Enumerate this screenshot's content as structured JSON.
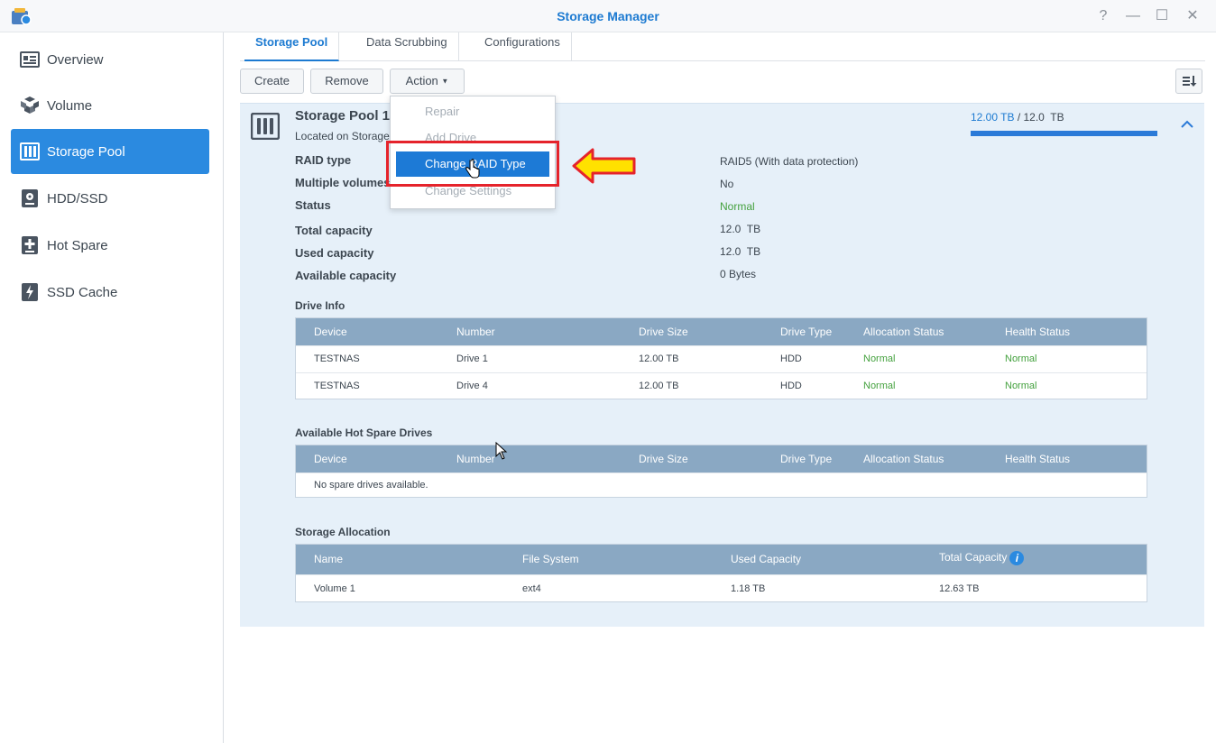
{
  "window": {
    "title": "Storage Manager",
    "controls": [
      "?",
      "—",
      "☐",
      "✕"
    ]
  },
  "sidebar": {
    "items": [
      {
        "label": "Overview",
        "icon": "overview-icon"
      },
      {
        "label": "Volume",
        "icon": "volume-icon"
      },
      {
        "label": "Storage Pool",
        "icon": "storage-pool-icon",
        "active": true
      },
      {
        "label": "HDD/SSD",
        "icon": "hdd-icon"
      },
      {
        "label": "Hot Spare",
        "icon": "hot-spare-icon"
      },
      {
        "label": "SSD Cache",
        "icon": "ssd-cache-icon"
      }
    ]
  },
  "tabs": [
    {
      "label": "Storage Pool",
      "active": true
    },
    {
      "label": "Data Scrubbing"
    },
    {
      "label": "Configurations"
    }
  ],
  "toolbar": {
    "create": "Create",
    "remove": "Remove",
    "action": "Action"
  },
  "pool": {
    "title": "Storage Pool 1",
    "location": "Located on Storage",
    "capacity_used_text": "12.00 TB",
    "capacity_sep": " / ",
    "capacity_total_text": "12.0  TB",
    "capacity_fraction": 1.0,
    "props": [
      {
        "label": "RAID type",
        "value": "RAID5  (With data protection)",
        "status": ""
      },
      {
        "label": "Multiple volumes",
        "value": "No",
        "status": ""
      },
      {
        "label": "Status",
        "value": "Normal",
        "status": "green"
      },
      {
        "label": "Total capacity",
        "value": "12.0  TB",
        "status": ""
      },
      {
        "label": "Used capacity",
        "value": "12.0  TB",
        "status": ""
      },
      {
        "label": "Available capacity",
        "value": "0 Bytes",
        "status": ""
      }
    ]
  },
  "drive_info": {
    "title": "Drive Info",
    "columns": [
      "Device",
      "Number",
      "Drive Size",
      "Drive Type",
      "Allocation Status",
      "Health Status"
    ],
    "rows": [
      [
        "TESTNAS",
        "Drive 1",
        "12.00 TB",
        "HDD",
        "Normal",
        "Normal"
      ],
      [
        "TESTNAS",
        "Drive 4",
        "12.00 TB",
        "HDD",
        "Normal",
        "Normal"
      ]
    ]
  },
  "hot_spare": {
    "title": "Available Hot Spare Drives",
    "columns": [
      "Device",
      "Number",
      "Drive Size",
      "Drive Type",
      "Allocation Status",
      "Health Status"
    ],
    "empty": "No spare drives available."
  },
  "allocation": {
    "title": "Storage Allocation",
    "columns": [
      "Name",
      "File System",
      "Used Capacity",
      "Total Capacity"
    ],
    "rows": [
      [
        "Volume 1",
        "ext4",
        "1.18 TB",
        "12.63 TB"
      ]
    ]
  },
  "action_menu": {
    "items": [
      {
        "label": "Repair",
        "selected": false
      },
      {
        "label": "Add Drive",
        "selected": false
      },
      {
        "label": "Change RAID Type",
        "selected": true
      },
      {
        "label": "Change Settings",
        "selected": false
      }
    ]
  },
  "colors": {
    "accent": "#1c7ad1",
    "active_nav": "#2b8ae0",
    "highlight": "#e5232b",
    "arrow": "#ffe100",
    "ok": "#44a13e"
  }
}
